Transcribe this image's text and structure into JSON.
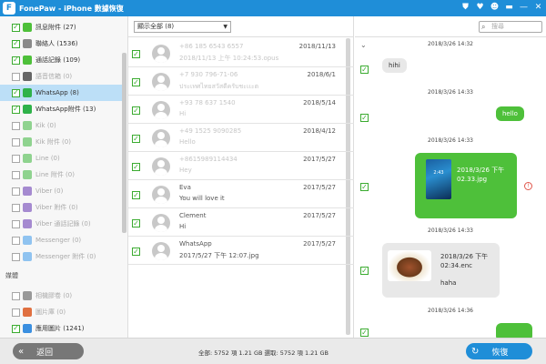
{
  "app": {
    "logo": "F",
    "title": "FonePaw - iPhone 數據恢復",
    "controls": [
      "⛊",
      "♥",
      "☻",
      "▬",
      "—",
      "✕"
    ]
  },
  "sidebar": {
    "items": [
      {
        "label": "訊息附件 (27)",
        "checked": true,
        "dim": false,
        "icon_color": "#4ec03a"
      },
      {
        "label": "聯絡人 (1536)",
        "checked": true,
        "dim": false,
        "icon_color": "#8a8a8a"
      },
      {
        "label": "通話記錄 (109)",
        "checked": true,
        "dim": false,
        "icon_color": "#4ec03a"
      },
      {
        "label": "語音信箱 (0)",
        "checked": false,
        "dim": true,
        "icon_color": "#666666"
      },
      {
        "label": "WhatsApp (8)",
        "checked": true,
        "dim": false,
        "icon_color": "#2fb24a",
        "selected": true
      },
      {
        "label": "WhatsApp附件 (13)",
        "checked": true,
        "dim": false,
        "icon_color": "#2fb24a"
      },
      {
        "label": "Kik (0)",
        "checked": false,
        "dim": true,
        "icon_color": "#8fd38f"
      },
      {
        "label": "Kik 附件 (0)",
        "checked": false,
        "dim": true,
        "icon_color": "#8fd38f"
      },
      {
        "label": "Line (0)",
        "checked": false,
        "dim": true,
        "icon_color": "#8fd38f"
      },
      {
        "label": "Line 附件 (0)",
        "checked": false,
        "dim": true,
        "icon_color": "#8fd38f"
      },
      {
        "label": "Viber (0)",
        "checked": false,
        "dim": true,
        "icon_color": "#a58ad0"
      },
      {
        "label": "Viber 附件 (0)",
        "checked": false,
        "dim": true,
        "icon_color": "#a58ad0"
      },
      {
        "label": "Viber 通話記錄 (0)",
        "checked": false,
        "dim": true,
        "icon_color": "#a58ad0"
      },
      {
        "label": "Messenger (0)",
        "checked": false,
        "dim": true,
        "icon_color": "#8fc3f0"
      },
      {
        "label": "Messenger 附件 (0)",
        "checked": false,
        "dim": true,
        "icon_color": "#8fc3f0"
      }
    ],
    "section_media": "媒體",
    "media_items": [
      {
        "label": "相機膠卷 (0)",
        "checked": false,
        "dim": true,
        "icon_color": "#999999"
      },
      {
        "label": "圖片庫 (0)",
        "checked": false,
        "dim": true,
        "icon_color": "#e07040"
      },
      {
        "label": "應用圖片 (1241)",
        "checked": true,
        "dim": false,
        "icon_color": "#3b8fe0"
      }
    ]
  },
  "middle": {
    "filter": "顯示全部 (8)",
    "conversations": [
      {
        "name": "+86 185 6543 6557",
        "snippet": "2018/11/13 上午 10:24:53.opus",
        "date": "2018/11/13",
        "blur": true
      },
      {
        "name": "+7 930 796-71-06",
        "snippet": "ประเทศไทยสวัสดีครับชะเเะต",
        "date": "2018/6/1",
        "blur": true
      },
      {
        "name": "+93 78 637 1540",
        "snippet": "Hi",
        "date": "2018/5/14",
        "blur": true
      },
      {
        "name": "+49 1525 9090285",
        "snippet": "Hello",
        "date": "2018/4/12",
        "blur": true
      },
      {
        "name": "+8615989114434",
        "snippet": "Hey",
        "date": "2017/5/27",
        "blur": true
      },
      {
        "name": "Eva",
        "snippet": "You will love it",
        "date": "2017/5/27",
        "blur": false
      },
      {
        "name": "Clement",
        "snippet": "Hi",
        "date": "2017/5/27",
        "blur": false
      },
      {
        "name": "WhatsApp",
        "snippet": "2017/5/27 下午 12:07.jpg",
        "date": "2017/5/27",
        "blur": false
      }
    ]
  },
  "right": {
    "search_placeholder": "搜尋",
    "messages": [
      {
        "ts": "2018/3/26 14:32",
        "text": "hihi",
        "dir": "in"
      },
      {
        "ts": "2018/3/26 14:33",
        "text": "hello",
        "dir": "out"
      },
      {
        "ts": "2018/3/26 14:33",
        "lock_time": "2:43",
        "text": "2018/3/26 下午\n02.33.jpg",
        "dir": "out"
      },
      {
        "ts": "2018/3/26 14:33",
        "text": "2018/3/26 下午\n02:34.enc",
        "caption": "haha",
        "dir": "in"
      },
      {
        "ts": "2018/3/26 14:36",
        "text": "",
        "dir": "out"
      }
    ]
  },
  "bottom": {
    "back_label": "返回",
    "summary": "全部: 5752 項 1.21 GB 選取: 5752 項 1.21 GB",
    "recover_label": "恢復"
  }
}
